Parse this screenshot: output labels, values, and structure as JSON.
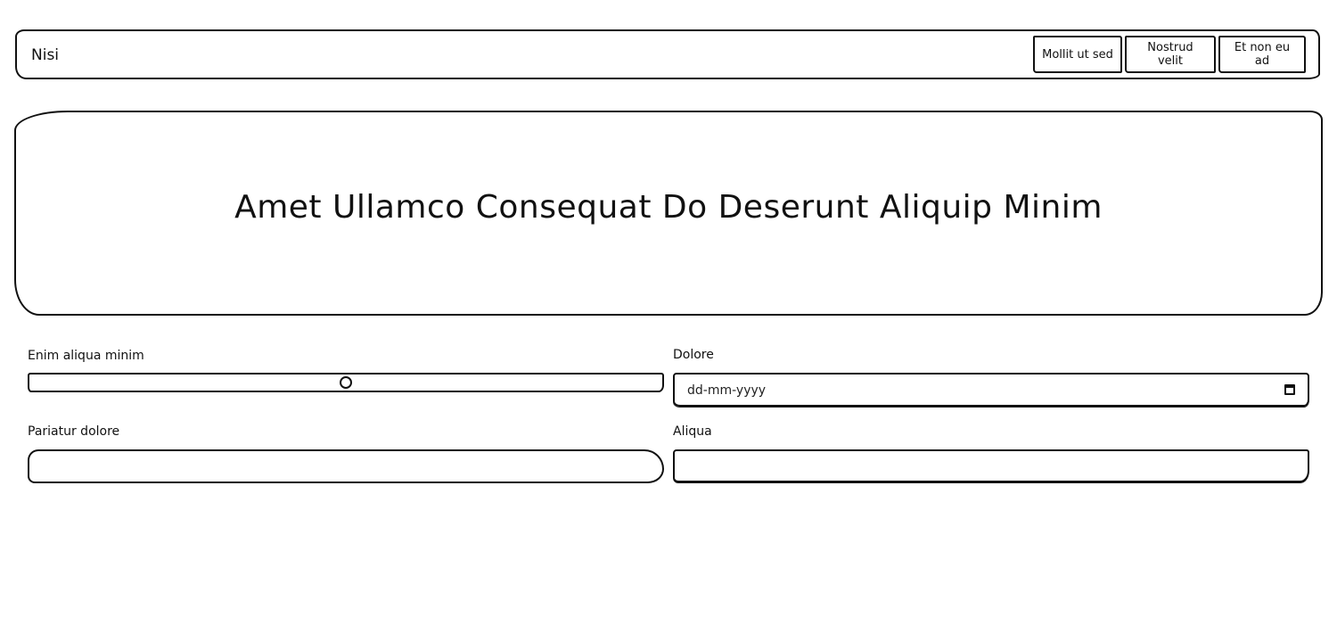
{
  "navbar": {
    "brand": "Nisi",
    "buttons": [
      {
        "label": "Mollit ut sed"
      },
      {
        "label": "Nostrud velit"
      },
      {
        "label": "Et non eu ad"
      }
    ]
  },
  "hero": {
    "title": "Amet Ullamco Consequat Do Deserunt Aliquip Minim"
  },
  "form": {
    "range_field": {
      "label": "Enim aliqua minim",
      "value": 0.5
    },
    "date_field": {
      "label": "Dolore",
      "placeholder": "dd-mm-yyyy",
      "icon": "calendar-icon"
    },
    "text_field_1": {
      "label": "Pariatur dolore",
      "value": ""
    },
    "text_field_2": {
      "label": "Aliqua",
      "value": ""
    }
  }
}
